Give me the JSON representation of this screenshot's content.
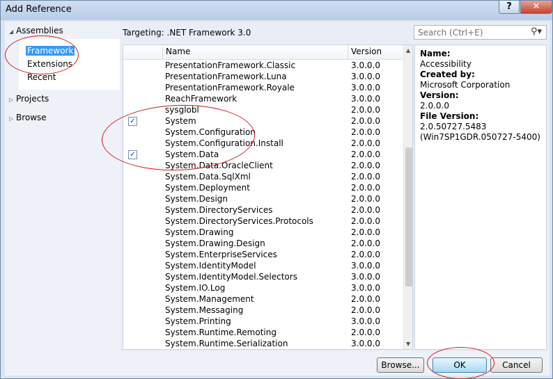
{
  "window": {
    "title": "Add Reference",
    "help_label": "?",
    "close_label": "✕"
  },
  "left_pane": {
    "sections": [
      {
        "label": "Assemblies",
        "expanded": true
      },
      {
        "label": "Projects",
        "expanded": false
      },
      {
        "label": "Browse",
        "expanded": false
      }
    ],
    "assembly_items": [
      "Framework",
      "Extensions",
      "Recent"
    ],
    "selected_item": "Framework"
  },
  "targeting": "Targeting: .NET Framework 3.0",
  "search": {
    "placeholder": "Search (Ctrl+E)",
    "icon": "search-icon"
  },
  "list": {
    "columns": {
      "name": "Name",
      "version": "Version"
    },
    "rows": [
      {
        "name": "PresentationFramework.Classic",
        "version": "3.0.0.0",
        "checked": false
      },
      {
        "name": "PresentationFramework.Luna",
        "version": "3.0.0.0",
        "checked": false
      },
      {
        "name": "PresentationFramework.Royale",
        "version": "3.0.0.0",
        "checked": false
      },
      {
        "name": "ReachFramework",
        "version": "3.0.0.0",
        "checked": false
      },
      {
        "name": "sysglobl",
        "version": "2.0.0.0",
        "checked": false
      },
      {
        "name": "System",
        "version": "2.0.0.0",
        "checked": true
      },
      {
        "name": "System.Configuration",
        "version": "2.0.0.0",
        "checked": false
      },
      {
        "name": "System.Configuration.Install",
        "version": "2.0.0.0",
        "checked": false
      },
      {
        "name": "System.Data",
        "version": "2.0.0.0",
        "checked": true
      },
      {
        "name": "System.Data.OracleClient",
        "version": "2.0.0.0",
        "checked": false
      },
      {
        "name": "System.Data.SqlXml",
        "version": "2.0.0.0",
        "checked": false
      },
      {
        "name": "System.Deployment",
        "version": "2.0.0.0",
        "checked": false
      },
      {
        "name": "System.Design",
        "version": "2.0.0.0",
        "checked": false
      },
      {
        "name": "System.DirectoryServices",
        "version": "2.0.0.0",
        "checked": false
      },
      {
        "name": "System.DirectoryServices.Protocols",
        "version": "2.0.0.0",
        "checked": false
      },
      {
        "name": "System.Drawing",
        "version": "2.0.0.0",
        "checked": false
      },
      {
        "name": "System.Drawing.Design",
        "version": "2.0.0.0",
        "checked": false
      },
      {
        "name": "System.EnterpriseServices",
        "version": "2.0.0.0",
        "checked": false
      },
      {
        "name": "System.IdentityModel",
        "version": "3.0.0.0",
        "checked": false
      },
      {
        "name": "System.IdentityModel.Selectors",
        "version": "3.0.0.0",
        "checked": false
      },
      {
        "name": "System.IO.Log",
        "version": "3.0.0.0",
        "checked": false
      },
      {
        "name": "System.Management",
        "version": "2.0.0.0",
        "checked": false
      },
      {
        "name": "System.Messaging",
        "version": "2.0.0.0",
        "checked": false
      },
      {
        "name": "System.Printing",
        "version": "3.0.0.0",
        "checked": false
      },
      {
        "name": "System.Runtime.Remoting",
        "version": "2.0.0.0",
        "checked": false
      },
      {
        "name": "System.Runtime.Serialization",
        "version": "3.0.0.0",
        "checked": false
      }
    ]
  },
  "details": {
    "name_label": "Name:",
    "name_value": "Accessibility",
    "created_label": "Created by:",
    "created_value": "Microsoft Corporation",
    "version_label": "Version:",
    "version_value": "2.0.0.0",
    "file_version_label": "File Version:",
    "file_version_value_1": "2.0.50727.5483",
    "file_version_value_2": "(Win7SP1GDR.050727-5400)"
  },
  "buttons": {
    "browse": "Browse...",
    "ok": "OK",
    "cancel": "Cancel"
  },
  "colors": {
    "selection": "#3399ff",
    "annotation": "#d01818",
    "titlebar": "#c3d5ec"
  }
}
